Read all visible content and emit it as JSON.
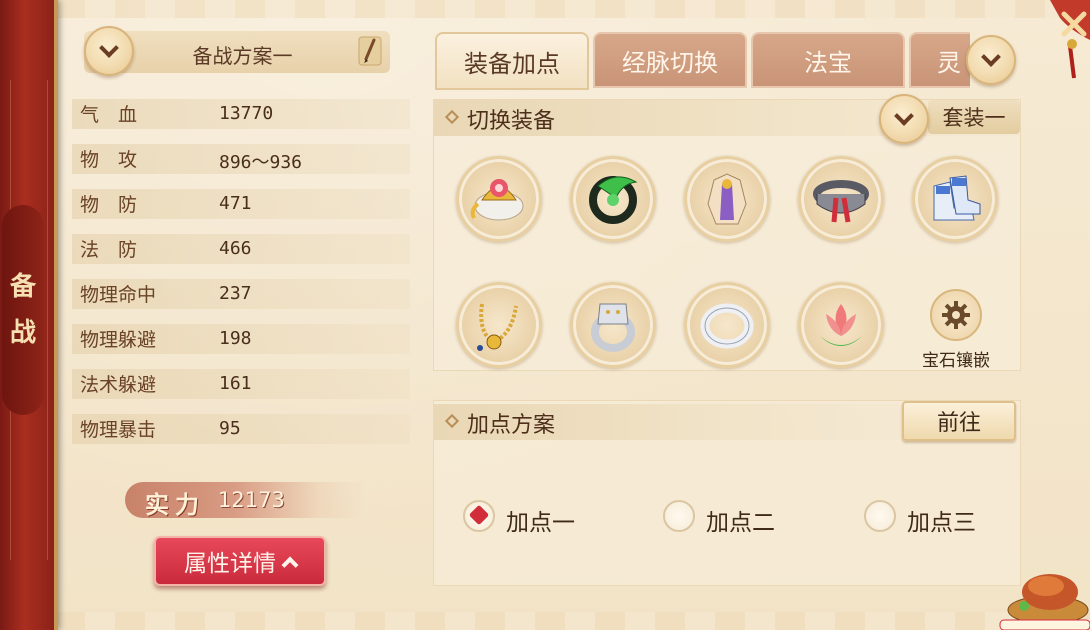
{
  "side_tab": {
    "chars": [
      "备",
      "战"
    ]
  },
  "scheme": {
    "name": "备战方案一"
  },
  "attributes": [
    {
      "name": "气　血",
      "value": "13770"
    },
    {
      "name": "物　攻",
      "value": "896～936"
    },
    {
      "name": "物　防",
      "value": "471"
    },
    {
      "name": "法　防",
      "value": "466"
    },
    {
      "name": "物理命中",
      "value": "237"
    },
    {
      "name": "物理躲避",
      "value": "198"
    },
    {
      "name": "法术躲避",
      "value": "161"
    },
    {
      "name": "物理暴击",
      "value": "95"
    }
  ],
  "power": {
    "label": "实力",
    "value": "12173"
  },
  "detail_button": {
    "label": "属性详情"
  },
  "tabs": [
    {
      "label": "装备加点",
      "active": true
    },
    {
      "label": "经脉切换",
      "active": false
    },
    {
      "label": "法宝",
      "active": false
    },
    {
      "label": "灵",
      "active": false
    }
  ],
  "equip_section": {
    "title": "切换装备",
    "suit_label": "套装一",
    "items": [
      {
        "icon": "helmet-icon"
      },
      {
        "icon": "jade-pendant-icon"
      },
      {
        "icon": "armor-robe-icon"
      },
      {
        "icon": "belt-icon"
      },
      {
        "icon": "boots-icon"
      },
      {
        "icon": "necklace-icon"
      },
      {
        "icon": "lion-ring-icon"
      },
      {
        "icon": "bracelet-icon"
      },
      {
        "icon": "lotus-charm-icon"
      }
    ],
    "gem_label": "宝石镶嵌"
  },
  "plan_section": {
    "title": "加点方案",
    "goto_label": "前往",
    "options": [
      {
        "label": "加点一",
        "checked": true
      },
      {
        "label": "加点二",
        "checked": false
      },
      {
        "label": "加点三",
        "checked": false
      }
    ]
  },
  "colors": {
    "banner_red": "#a92e20",
    "button_red": "#d22d3a",
    "parchment": "#f4e7cf",
    "text_brown": "#5a3a26"
  }
}
